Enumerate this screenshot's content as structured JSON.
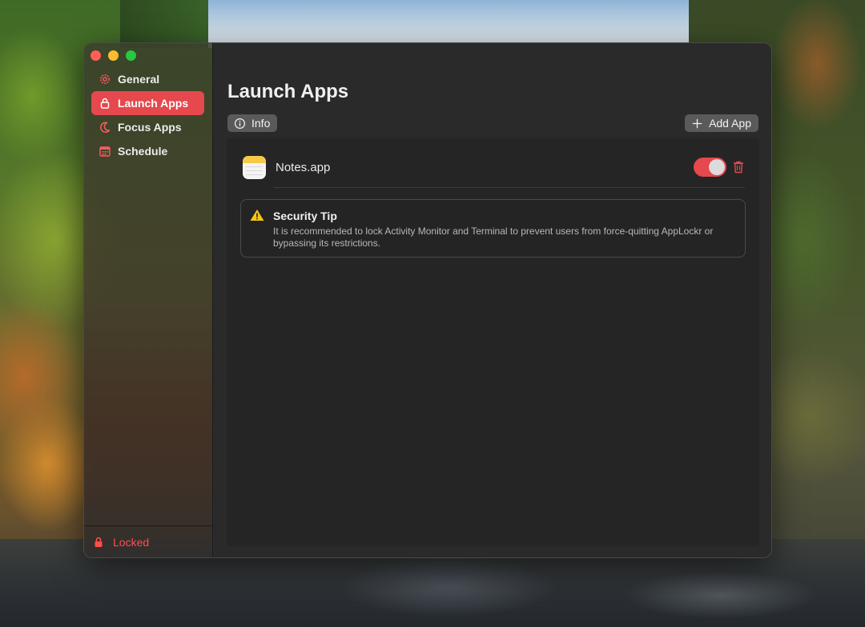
{
  "window": {
    "traffic_lights": [
      "close",
      "minimize",
      "zoom"
    ]
  },
  "sidebar": {
    "items": [
      {
        "label": "General",
        "icon": "gear-icon",
        "active": false
      },
      {
        "label": "Launch Apps",
        "icon": "lock-icon",
        "active": true
      },
      {
        "label": "Focus Apps",
        "icon": "moon-icon",
        "active": false
      },
      {
        "label": "Schedule",
        "icon": "calendar-icon",
        "active": false
      }
    ],
    "footer": {
      "label": "Locked",
      "icon": "lock-icon"
    }
  },
  "main": {
    "title": "Launch Apps",
    "info_button": {
      "label": "Info",
      "icon": "info-circle-icon"
    },
    "add_button": {
      "label": "Add App",
      "icon": "plus-icon"
    },
    "apps": [
      {
        "name": "Notes.app",
        "icon": "notes-app-icon",
        "enabled": true
      }
    ],
    "security_tip": {
      "title": "Security Tip",
      "icon": "warning-icon",
      "body": "It is recommended to lock Activity Monitor and Terminal to prevent users from force-quitting AppLockr or bypassing its restrictions."
    }
  },
  "colors": {
    "accent": "#e5484d",
    "locked_text": "#ff4d4f",
    "warning": "#f5c518",
    "window_bg": "#2a2a2a"
  }
}
